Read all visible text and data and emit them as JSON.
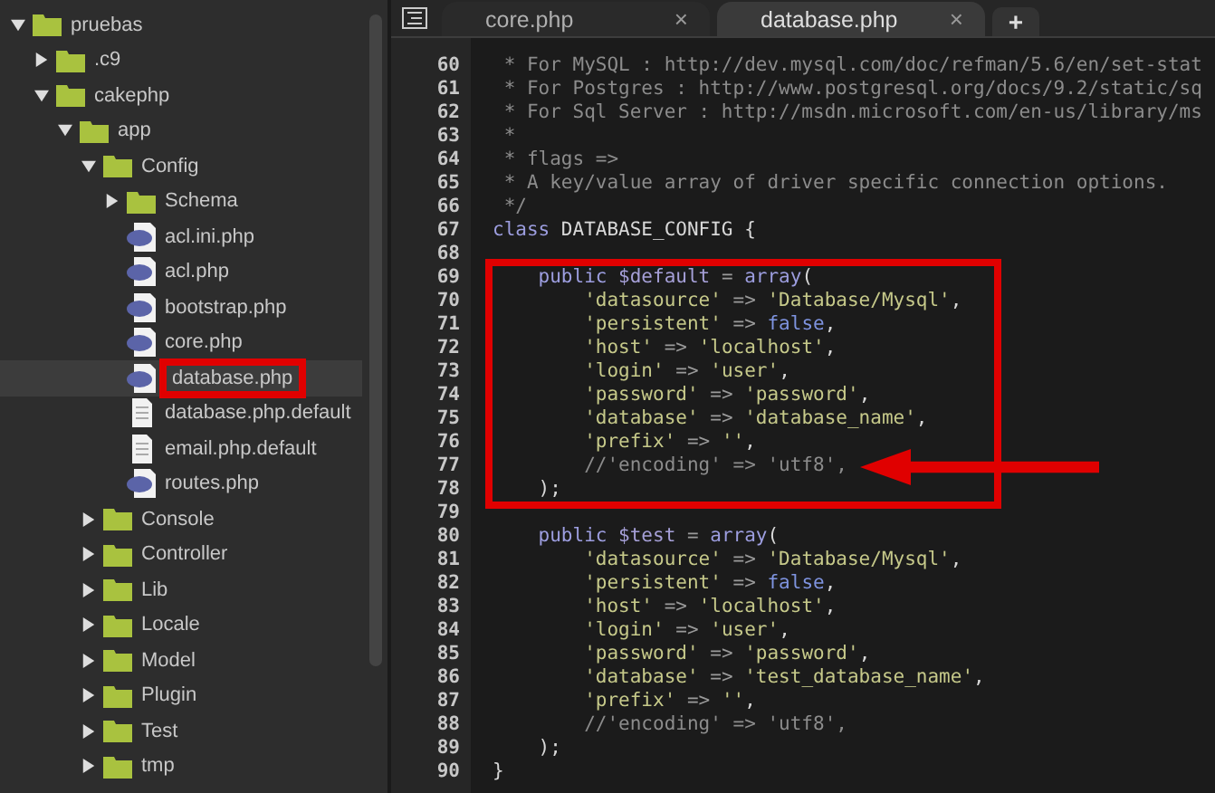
{
  "sidebar": {
    "tree": [
      {
        "kind": "folder",
        "label": "pruebas",
        "expanded": true,
        "selected": false,
        "boxed": false,
        "children": [
          {
            "kind": "folder",
            "label": ".c9",
            "expanded": false,
            "selected": false,
            "boxed": false
          },
          {
            "kind": "folder",
            "label": "cakephp",
            "expanded": true,
            "selected": false,
            "boxed": false,
            "children": [
              {
                "kind": "folder",
                "label": "app",
                "expanded": true,
                "selected": false,
                "boxed": false,
                "children": [
                  {
                    "kind": "folder",
                    "label": "Config",
                    "expanded": true,
                    "selected": false,
                    "boxed": false,
                    "children": [
                      {
                        "kind": "folder",
                        "label": "Schema",
                        "expanded": false,
                        "selected": false,
                        "boxed": false
                      },
                      {
                        "kind": "php",
                        "label": "acl.ini.php",
                        "selected": false,
                        "boxed": false
                      },
                      {
                        "kind": "php",
                        "label": "acl.php",
                        "selected": false,
                        "boxed": false
                      },
                      {
                        "kind": "php",
                        "label": "bootstrap.php",
                        "selected": false,
                        "boxed": false
                      },
                      {
                        "kind": "php",
                        "label": "core.php",
                        "selected": false,
                        "boxed": false
                      },
                      {
                        "kind": "php",
                        "label": "database.php",
                        "selected": true,
                        "boxed": true
                      },
                      {
                        "kind": "text",
                        "label": "database.php.default",
                        "selected": false,
                        "boxed": false
                      },
                      {
                        "kind": "text",
                        "label": "email.php.default",
                        "selected": false,
                        "boxed": false
                      },
                      {
                        "kind": "php",
                        "label": "routes.php",
                        "selected": false,
                        "boxed": false
                      }
                    ]
                  },
                  {
                    "kind": "folder",
                    "label": "Console",
                    "expanded": false,
                    "selected": false,
                    "boxed": false
                  },
                  {
                    "kind": "folder",
                    "label": "Controller",
                    "expanded": false,
                    "selected": false,
                    "boxed": false
                  },
                  {
                    "kind": "folder",
                    "label": "Lib",
                    "expanded": false,
                    "selected": false,
                    "boxed": false
                  },
                  {
                    "kind": "folder",
                    "label": "Locale",
                    "expanded": false,
                    "selected": false,
                    "boxed": false
                  },
                  {
                    "kind": "folder",
                    "label": "Model",
                    "expanded": false,
                    "selected": false,
                    "boxed": false
                  },
                  {
                    "kind": "folder",
                    "label": "Plugin",
                    "expanded": false,
                    "selected": false,
                    "boxed": false
                  },
                  {
                    "kind": "folder",
                    "label": "Test",
                    "expanded": false,
                    "selected": false,
                    "boxed": false
                  },
                  {
                    "kind": "folder",
                    "label": "tmp",
                    "expanded": false,
                    "selected": false,
                    "boxed": false
                  }
                ]
              }
            ]
          }
        ]
      }
    ]
  },
  "tabs": [
    {
      "label": "core.php",
      "selected": false,
      "close": "×"
    },
    {
      "label": "database.php",
      "selected": true,
      "close": "×"
    }
  ],
  "new_tab": "+",
  "editor": {
    "blocks": [
      {
        "highlighted": false,
        "arrow": false,
        "lines": [
          {
            "number": "60",
            "tokens": [
              {
                "kind": "comment",
                "text": " * For MySQL : http://dev.mysql.com/doc/refman/5.6/en/set-stat"
              }
            ]
          },
          {
            "number": "61",
            "tokens": [
              {
                "kind": "comment",
                "text": " * For Postgres : http://www.postgresql.org/docs/9.2/static/sq"
              }
            ]
          },
          {
            "number": "62",
            "tokens": [
              {
                "kind": "comment",
                "text": " * For Sql Server : http://msdn.microsoft.com/en-us/library/ms"
              }
            ]
          },
          {
            "number": "63",
            "tokens": [
              {
                "kind": "comment",
                "text": " *"
              }
            ]
          },
          {
            "number": "64",
            "tokens": [
              {
                "kind": "comment",
                "text": " * flags =>"
              }
            ]
          },
          {
            "number": "65",
            "tokens": [
              {
                "kind": "comment",
                "text": " * A key/value array of driver specific connection options."
              }
            ]
          },
          {
            "number": "66",
            "tokens": [
              {
                "kind": "comment",
                "text": " */"
              }
            ]
          },
          {
            "number": "67",
            "tokens": [
              {
                "kind": "keyword",
                "text": "class"
              },
              {
                "kind": "plain",
                "text": " DATABASE_CONFIG {"
              }
            ]
          },
          {
            "number": "68"
          }
        ]
      },
      {
        "highlighted": true,
        "arrow": true,
        "lines": [
          {
            "number": "69",
            "tokens": [
              {
                "kind": "keyword",
                "text": "    public"
              },
              {
                "kind": "variable",
                "text": " $default"
              },
              {
                "kind": "operator",
                "text": " = "
              },
              {
                "kind": "keyword",
                "text": "array"
              },
              {
                "kind": "plain",
                "text": "("
              }
            ]
          },
          {
            "number": "70",
            "tokens": [
              {
                "kind": "string",
                "text": "        'datasource'"
              },
              {
                "kind": "operator",
                "text": " => "
              },
              {
                "kind": "string",
                "text": "'Database/Mysql'"
              },
              {
                "kind": "plain",
                "text": ","
              }
            ]
          },
          {
            "number": "71",
            "tokens": [
              {
                "kind": "string",
                "text": "        'persistent'"
              },
              {
                "kind": "operator",
                "text": " => "
              },
              {
                "kind": "constant",
                "text": "false"
              },
              {
                "kind": "plain",
                "text": ","
              }
            ]
          },
          {
            "number": "72",
            "tokens": [
              {
                "kind": "string",
                "text": "        'host'"
              },
              {
                "kind": "operator",
                "text": " => "
              },
              {
                "kind": "string",
                "text": "'localhost'"
              },
              {
                "kind": "plain",
                "text": ","
              }
            ]
          },
          {
            "number": "73",
            "tokens": [
              {
                "kind": "string",
                "text": "        'login'"
              },
              {
                "kind": "operator",
                "text": " => "
              },
              {
                "kind": "string",
                "text": "'user'"
              },
              {
                "kind": "plain",
                "text": ","
              }
            ]
          },
          {
            "number": "74",
            "tokens": [
              {
                "kind": "string",
                "text": "        'password'"
              },
              {
                "kind": "operator",
                "text": " => "
              },
              {
                "kind": "string",
                "text": "'password'"
              },
              {
                "kind": "plain",
                "text": ","
              }
            ]
          },
          {
            "number": "75",
            "tokens": [
              {
                "kind": "string",
                "text": "        'database'"
              },
              {
                "kind": "operator",
                "text": " => "
              },
              {
                "kind": "string",
                "text": "'database_name'"
              },
              {
                "kind": "plain",
                "text": ","
              }
            ]
          },
          {
            "number": "76",
            "tokens": [
              {
                "kind": "string",
                "text": "        'prefix'"
              },
              {
                "kind": "operator",
                "text": " => "
              },
              {
                "kind": "string",
                "text": "''"
              },
              {
                "kind": "plain",
                "text": ","
              }
            ]
          },
          {
            "number": "77",
            "tokens": [
              {
                "kind": "comment",
                "text": "        //'encoding' => 'utf8',"
              }
            ]
          },
          {
            "number": "78",
            "tokens": [
              {
                "kind": "plain",
                "text": "    );"
              }
            ]
          }
        ]
      },
      {
        "highlighted": false,
        "arrow": false,
        "lines": [
          {
            "number": "79"
          },
          {
            "number": "80",
            "tokens": [
              {
                "kind": "keyword",
                "text": "    public"
              },
              {
                "kind": "variable",
                "text": " $test"
              },
              {
                "kind": "operator",
                "text": " = "
              },
              {
                "kind": "keyword",
                "text": "array"
              },
              {
                "kind": "plain",
                "text": "("
              }
            ]
          },
          {
            "number": "81",
            "tokens": [
              {
                "kind": "string",
                "text": "        'datasource'"
              },
              {
                "kind": "operator",
                "text": " => "
              },
              {
                "kind": "string",
                "text": "'Database/Mysql'"
              },
              {
                "kind": "plain",
                "text": ","
              }
            ]
          },
          {
            "number": "82",
            "tokens": [
              {
                "kind": "string",
                "text": "        'persistent'"
              },
              {
                "kind": "operator",
                "text": " => "
              },
              {
                "kind": "constant",
                "text": "false"
              },
              {
                "kind": "plain",
                "text": ","
              }
            ]
          },
          {
            "number": "83",
            "tokens": [
              {
                "kind": "string",
                "text": "        'host'"
              },
              {
                "kind": "operator",
                "text": " => "
              },
              {
                "kind": "string",
                "text": "'localhost'"
              },
              {
                "kind": "plain",
                "text": ","
              }
            ]
          },
          {
            "number": "84",
            "tokens": [
              {
                "kind": "string",
                "text": "        'login'"
              },
              {
                "kind": "operator",
                "text": " => "
              },
              {
                "kind": "string",
                "text": "'user'"
              },
              {
                "kind": "plain",
                "text": ","
              }
            ]
          },
          {
            "number": "85",
            "tokens": [
              {
                "kind": "string",
                "text": "        'password'"
              },
              {
                "kind": "operator",
                "text": " => "
              },
              {
                "kind": "string",
                "text": "'password'"
              },
              {
                "kind": "plain",
                "text": ","
              }
            ]
          },
          {
            "number": "86",
            "tokens": [
              {
                "kind": "string",
                "text": "        'database'"
              },
              {
                "kind": "operator",
                "text": " => "
              },
              {
                "kind": "string",
                "text": "'test_database_name'"
              },
              {
                "kind": "plain",
                "text": ","
              }
            ]
          },
          {
            "number": "87",
            "tokens": [
              {
                "kind": "string",
                "text": "        'prefix'"
              },
              {
                "kind": "operator",
                "text": " => "
              },
              {
                "kind": "string",
                "text": "''"
              },
              {
                "kind": "plain",
                "text": ","
              }
            ]
          },
          {
            "number": "88",
            "tokens": [
              {
                "kind": "comment",
                "text": "        //'encoding' => 'utf8',"
              }
            ]
          },
          {
            "number": "89",
            "tokens": [
              {
                "kind": "plain",
                "text": "    );"
              }
            ]
          },
          {
            "number": "90",
            "tokens": [
              {
                "kind": "plain",
                "text": "}"
              }
            ]
          }
        ]
      }
    ]
  }
}
